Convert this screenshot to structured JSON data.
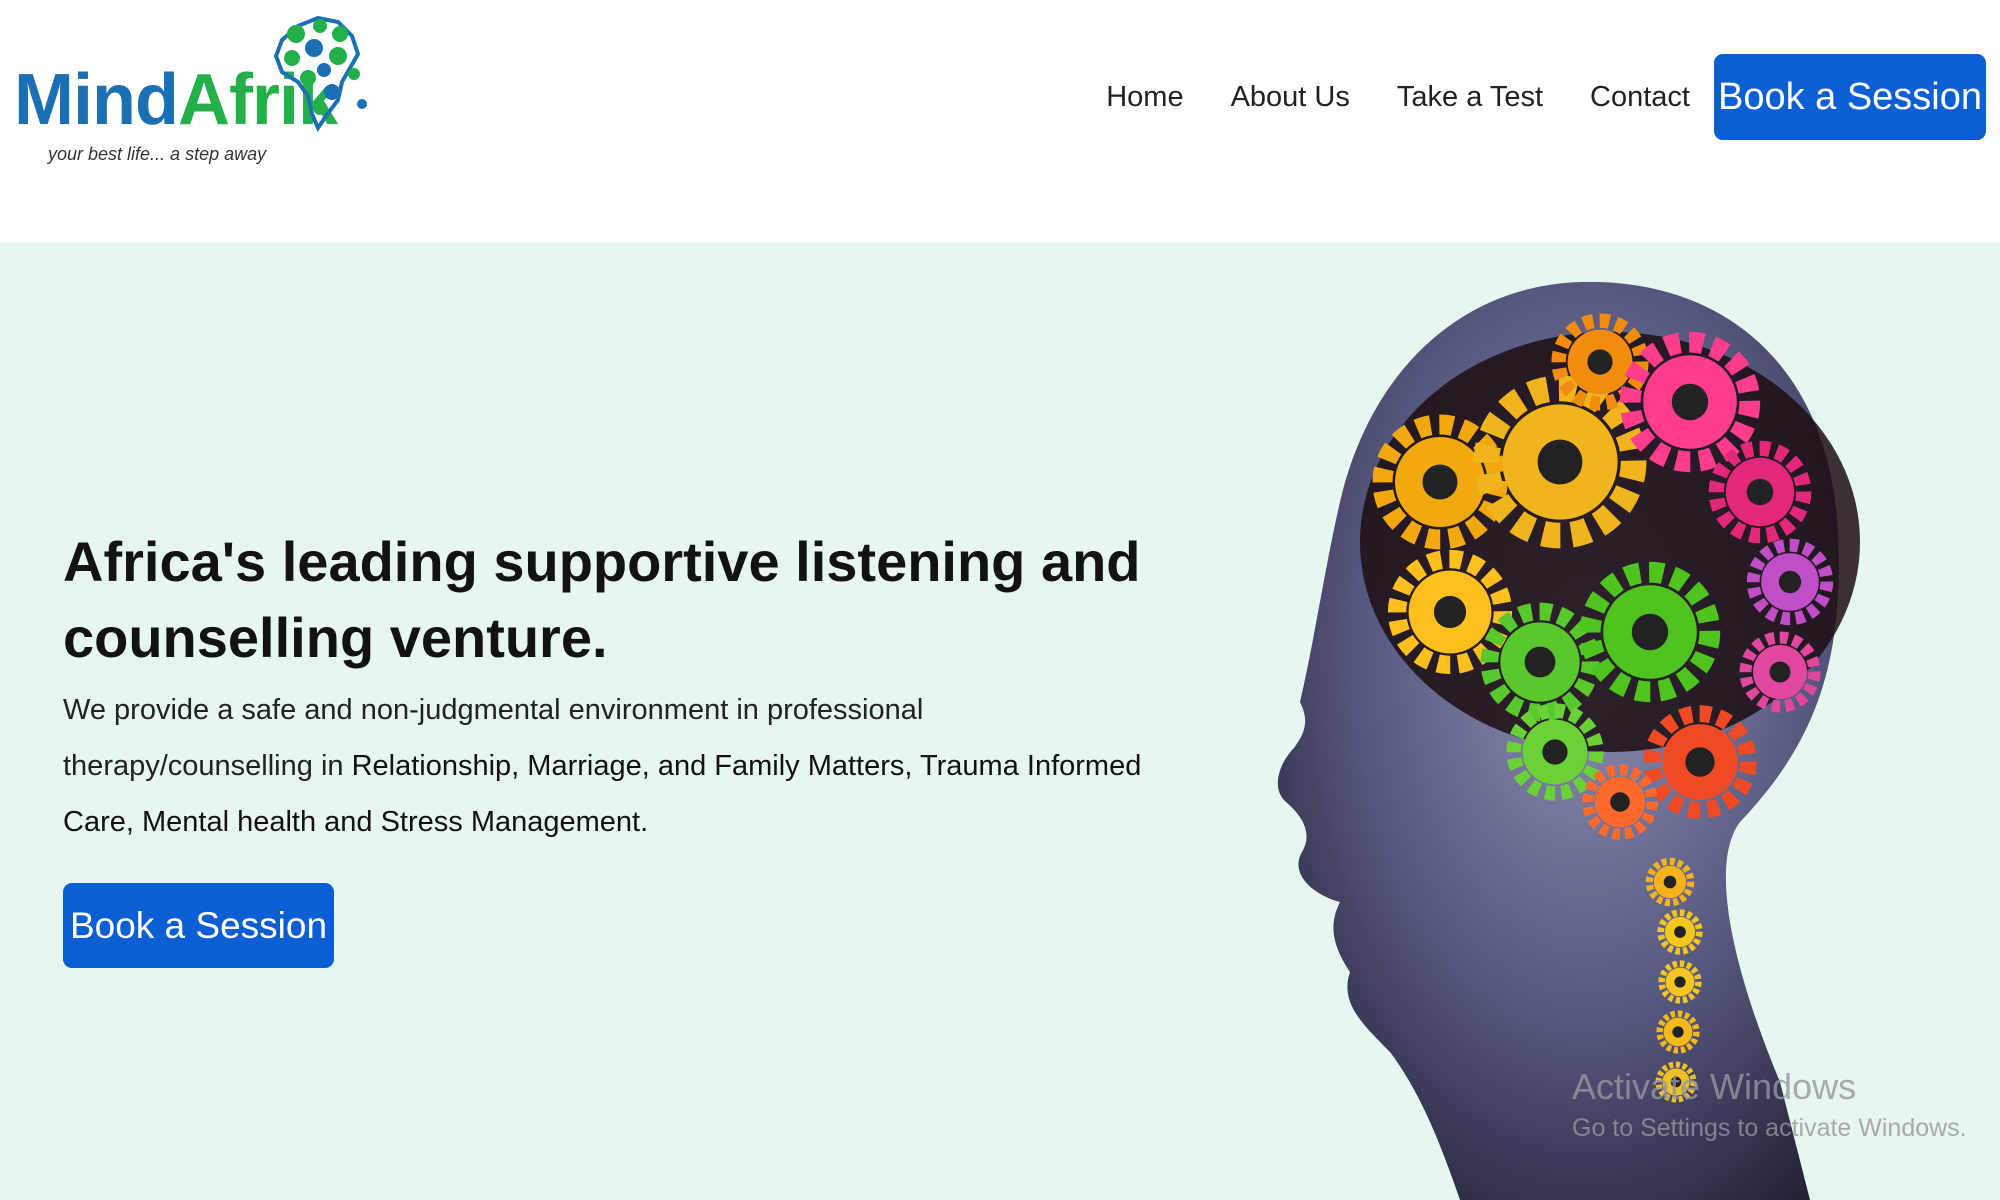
{
  "brand": {
    "name_part1": "Mind",
    "name_part2": "Afrik",
    "tagline": "your best life... a step away",
    "colors": {
      "blue": "#1a6fb5",
      "green": "#23b04a"
    }
  },
  "nav": {
    "links": [
      "Home",
      "About Us",
      "Take a Test",
      "Contact"
    ],
    "cta_label": "Book a Session"
  },
  "hero": {
    "title": "Africa's leading supportive listening and counselling venture.",
    "description_intro": "We provide a safe and non-judgmental environment in professional therapy/counselling in",
    "description_focus": "Relationship, Marriage, and Family Matters, Trauma Informed Care, Mental health and Stress Management.",
    "cta_label": "Book a Session",
    "image_icon": "brain-gears-head-illustration",
    "background": "#e7f6ee",
    "button_color": "#0b5fd3"
  },
  "watermark": {
    "title": "Activate Windows",
    "subtitle": "Go to Settings to activate Windows."
  }
}
